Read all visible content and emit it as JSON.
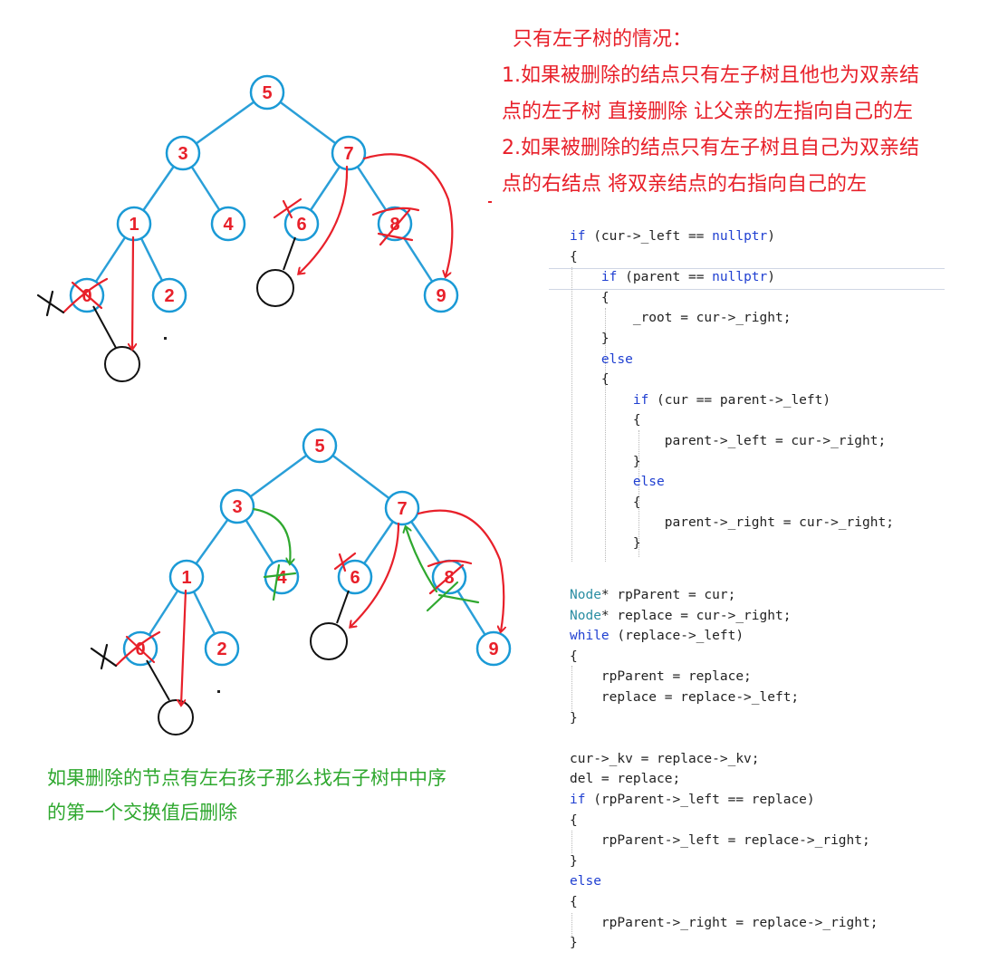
{
  "notes": {
    "title": "只有左子树的情况：",
    "line1": "1.如果被删除的结点只有左子树且他也为双亲结",
    "line2": "点的左子树 直接删除 让父亲的左指向自己的左",
    "line3": "2.如果被删除的结点只有左子树且自己为双亲结",
    "line4": "点的右结点 将双亲结点的右指向自己的左",
    "bottom1": "如果删除的节点有左右孩子那么找右子树中中序",
    "bottom2": "的第一个交换值后删除"
  },
  "tree_top": {
    "nodes": [
      "5",
      "3",
      "7",
      "1",
      "4",
      "6",
      "8",
      "0",
      "2",
      "9"
    ]
  },
  "tree_bottom": {
    "nodes": [
      "5",
      "3",
      "7",
      "1",
      "4",
      "6",
      "8",
      "0",
      "2",
      "9"
    ]
  },
  "code1": [
    [
      "if",
      " (cur->_left == ",
      "nullptr",
      ")"
    ],
    [
      "{"
    ],
    [
      "    ",
      "if",
      " (parent == ",
      "nullptr",
      ")"
    ],
    [
      "    {"
    ],
    [
      "        _root = cur->_right;"
    ],
    [
      "    }"
    ],
    [
      "    ",
      "else"
    ],
    [
      "    {"
    ],
    [
      "        ",
      "if",
      " (cur == parent->_left)"
    ],
    [
      "        {"
    ],
    [
      "            parent->_left = cur->_right;"
    ],
    [
      "        }"
    ],
    [
      "        ",
      "else"
    ],
    [
      "        {"
    ],
    [
      "            parent->_right = cur->_right;"
    ],
    [
      "        }"
    ]
  ],
  "code2": [
    [
      "Node",
      "* rpParent = cur;"
    ],
    [
      "Node",
      "* replace = cur->_right;"
    ],
    [
      "while",
      " (replace->_left)"
    ],
    [
      "{"
    ],
    [
      "    rpParent = replace;"
    ],
    [
      "    replace = replace->_left;"
    ],
    [
      "}"
    ],
    [
      ""
    ],
    [
      "cur->_kv = replace->_kv;"
    ],
    [
      "del = replace;"
    ],
    [
      "if",
      " (rpParent->_left == replace)"
    ],
    [
      "{"
    ],
    [
      "    rpParent->_left = replace->_right;"
    ],
    [
      "}"
    ],
    [
      "else"
    ],
    [
      "{"
    ],
    [
      "    rpParent->_right = replace->_right;"
    ],
    [
      "}"
    ]
  ],
  "colors": {
    "node_stroke": "#1a9ad6",
    "edge": "#2a9fd8",
    "label": "#e8202a",
    "annotation_red": "#e8202a",
    "annotation_green": "#2fa82f",
    "keyword": "#1f3fd1",
    "type": "#2b8ea3"
  }
}
